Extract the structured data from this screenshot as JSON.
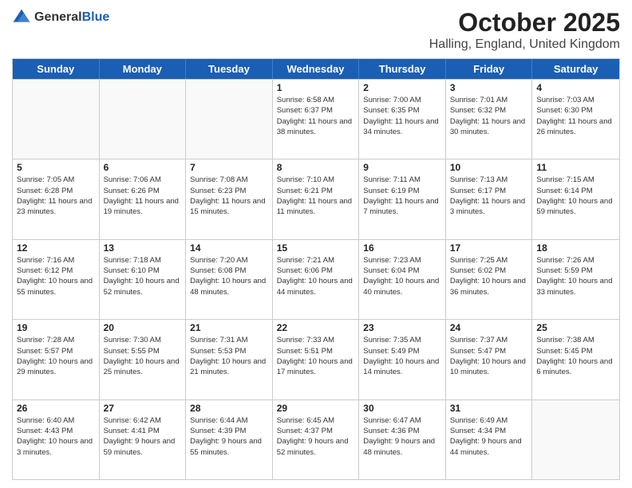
{
  "header": {
    "logo_general": "General",
    "logo_blue": "Blue",
    "title": "October 2025",
    "subtitle": "Halling, England, United Kingdom"
  },
  "weekdays": [
    "Sunday",
    "Monday",
    "Tuesday",
    "Wednesday",
    "Thursday",
    "Friday",
    "Saturday"
  ],
  "rows": [
    [
      {
        "day": "",
        "sunrise": "",
        "sunset": "",
        "daylight": ""
      },
      {
        "day": "",
        "sunrise": "",
        "sunset": "",
        "daylight": ""
      },
      {
        "day": "",
        "sunrise": "",
        "sunset": "",
        "daylight": ""
      },
      {
        "day": "1",
        "sunrise": "Sunrise: 6:58 AM",
        "sunset": "Sunset: 6:37 PM",
        "daylight": "Daylight: 11 hours and 38 minutes."
      },
      {
        "day": "2",
        "sunrise": "Sunrise: 7:00 AM",
        "sunset": "Sunset: 6:35 PM",
        "daylight": "Daylight: 11 hours and 34 minutes."
      },
      {
        "day": "3",
        "sunrise": "Sunrise: 7:01 AM",
        "sunset": "Sunset: 6:32 PM",
        "daylight": "Daylight: 11 hours and 30 minutes."
      },
      {
        "day": "4",
        "sunrise": "Sunrise: 7:03 AM",
        "sunset": "Sunset: 6:30 PM",
        "daylight": "Daylight: 11 hours and 26 minutes."
      }
    ],
    [
      {
        "day": "5",
        "sunrise": "Sunrise: 7:05 AM",
        "sunset": "Sunset: 6:28 PM",
        "daylight": "Daylight: 11 hours and 23 minutes."
      },
      {
        "day": "6",
        "sunrise": "Sunrise: 7:06 AM",
        "sunset": "Sunset: 6:26 PM",
        "daylight": "Daylight: 11 hours and 19 minutes."
      },
      {
        "day": "7",
        "sunrise": "Sunrise: 7:08 AM",
        "sunset": "Sunset: 6:23 PM",
        "daylight": "Daylight: 11 hours and 15 minutes."
      },
      {
        "day": "8",
        "sunrise": "Sunrise: 7:10 AM",
        "sunset": "Sunset: 6:21 PM",
        "daylight": "Daylight: 11 hours and 11 minutes."
      },
      {
        "day": "9",
        "sunrise": "Sunrise: 7:11 AM",
        "sunset": "Sunset: 6:19 PM",
        "daylight": "Daylight: 11 hours and 7 minutes."
      },
      {
        "day": "10",
        "sunrise": "Sunrise: 7:13 AM",
        "sunset": "Sunset: 6:17 PM",
        "daylight": "Daylight: 11 hours and 3 minutes."
      },
      {
        "day": "11",
        "sunrise": "Sunrise: 7:15 AM",
        "sunset": "Sunset: 6:14 PM",
        "daylight": "Daylight: 10 hours and 59 minutes."
      }
    ],
    [
      {
        "day": "12",
        "sunrise": "Sunrise: 7:16 AM",
        "sunset": "Sunset: 6:12 PM",
        "daylight": "Daylight: 10 hours and 55 minutes."
      },
      {
        "day": "13",
        "sunrise": "Sunrise: 7:18 AM",
        "sunset": "Sunset: 6:10 PM",
        "daylight": "Daylight: 10 hours and 52 minutes."
      },
      {
        "day": "14",
        "sunrise": "Sunrise: 7:20 AM",
        "sunset": "Sunset: 6:08 PM",
        "daylight": "Daylight: 10 hours and 48 minutes."
      },
      {
        "day": "15",
        "sunrise": "Sunrise: 7:21 AM",
        "sunset": "Sunset: 6:06 PM",
        "daylight": "Daylight: 10 hours and 44 minutes."
      },
      {
        "day": "16",
        "sunrise": "Sunrise: 7:23 AM",
        "sunset": "Sunset: 6:04 PM",
        "daylight": "Daylight: 10 hours and 40 minutes."
      },
      {
        "day": "17",
        "sunrise": "Sunrise: 7:25 AM",
        "sunset": "Sunset: 6:02 PM",
        "daylight": "Daylight: 10 hours and 36 minutes."
      },
      {
        "day": "18",
        "sunrise": "Sunrise: 7:26 AM",
        "sunset": "Sunset: 5:59 PM",
        "daylight": "Daylight: 10 hours and 33 minutes."
      }
    ],
    [
      {
        "day": "19",
        "sunrise": "Sunrise: 7:28 AM",
        "sunset": "Sunset: 5:57 PM",
        "daylight": "Daylight: 10 hours and 29 minutes."
      },
      {
        "day": "20",
        "sunrise": "Sunrise: 7:30 AM",
        "sunset": "Sunset: 5:55 PM",
        "daylight": "Daylight: 10 hours and 25 minutes."
      },
      {
        "day": "21",
        "sunrise": "Sunrise: 7:31 AM",
        "sunset": "Sunset: 5:53 PM",
        "daylight": "Daylight: 10 hours and 21 minutes."
      },
      {
        "day": "22",
        "sunrise": "Sunrise: 7:33 AM",
        "sunset": "Sunset: 5:51 PM",
        "daylight": "Daylight: 10 hours and 17 minutes."
      },
      {
        "day": "23",
        "sunrise": "Sunrise: 7:35 AM",
        "sunset": "Sunset: 5:49 PM",
        "daylight": "Daylight: 10 hours and 14 minutes."
      },
      {
        "day": "24",
        "sunrise": "Sunrise: 7:37 AM",
        "sunset": "Sunset: 5:47 PM",
        "daylight": "Daylight: 10 hours and 10 minutes."
      },
      {
        "day": "25",
        "sunrise": "Sunrise: 7:38 AM",
        "sunset": "Sunset: 5:45 PM",
        "daylight": "Daylight: 10 hours and 6 minutes."
      }
    ],
    [
      {
        "day": "26",
        "sunrise": "Sunrise: 6:40 AM",
        "sunset": "Sunset: 4:43 PM",
        "daylight": "Daylight: 10 hours and 3 minutes."
      },
      {
        "day": "27",
        "sunrise": "Sunrise: 6:42 AM",
        "sunset": "Sunset: 4:41 PM",
        "daylight": "Daylight: 9 hours and 59 minutes."
      },
      {
        "day": "28",
        "sunrise": "Sunrise: 6:44 AM",
        "sunset": "Sunset: 4:39 PM",
        "daylight": "Daylight: 9 hours and 55 minutes."
      },
      {
        "day": "29",
        "sunrise": "Sunrise: 6:45 AM",
        "sunset": "Sunset: 4:37 PM",
        "daylight": "Daylight: 9 hours and 52 minutes."
      },
      {
        "day": "30",
        "sunrise": "Sunrise: 6:47 AM",
        "sunset": "Sunset: 4:36 PM",
        "daylight": "Daylight: 9 hours and 48 minutes."
      },
      {
        "day": "31",
        "sunrise": "Sunrise: 6:49 AM",
        "sunset": "Sunset: 4:34 PM",
        "daylight": "Daylight: 9 hours and 44 minutes."
      },
      {
        "day": "",
        "sunrise": "",
        "sunset": "",
        "daylight": ""
      }
    ]
  ]
}
